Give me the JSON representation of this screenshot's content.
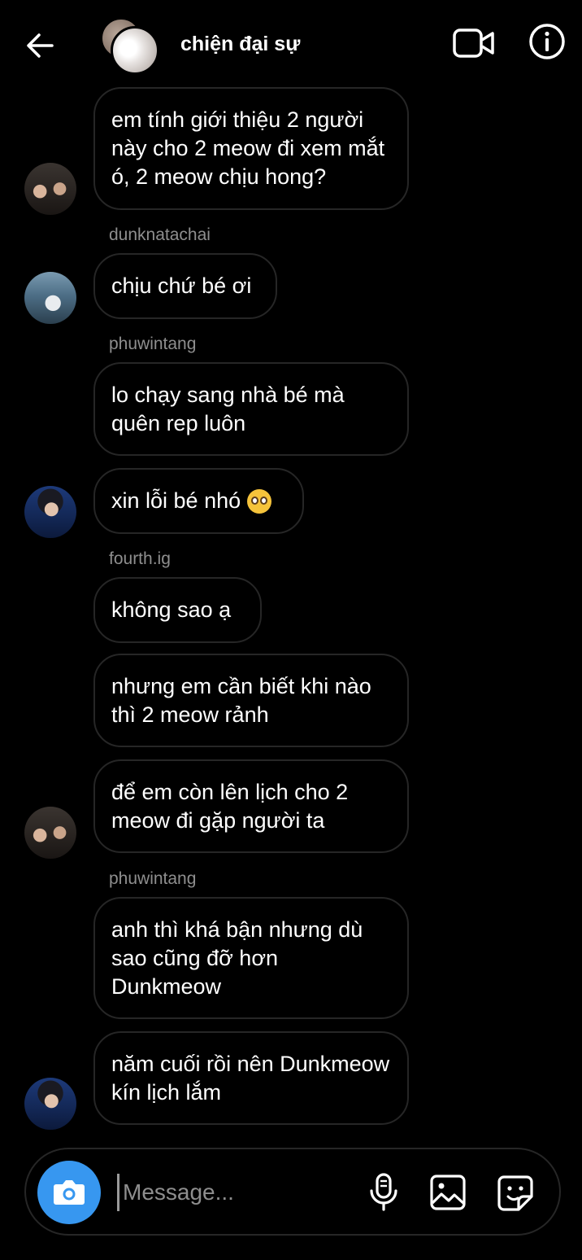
{
  "header": {
    "title": "chiện đại sự",
    "back_icon": "arrow-left-icon",
    "video_icon": "video-call-icon",
    "info_icon": "info-icon"
  },
  "messages": [
    {
      "text": "em tính giới thiệu 2 người này cho 2 meow đi xem mắt ó, 2 meow chịu hong?"
    },
    {
      "username": "dunknatachai",
      "text": "chịu chứ bé ơi"
    },
    {
      "username": "phuwintang",
      "text": "lo chạy sang nhà bé mà quên rep luôn"
    },
    {
      "text": "xin lỗi bé nhó"
    },
    {
      "username": "fourth.ig",
      "text": "không sao ạ"
    },
    {
      "text": "nhưng em cần biết khi nào thì 2 meow rảnh"
    },
    {
      "text": "để em còn lên lịch cho 2 meow đi gặp người ta"
    },
    {
      "username": "phuwintang",
      "text": "anh thì khá bận nhưng dù sao cũng đỡ hơn Dunkmeow"
    },
    {
      "text": "năm cuối rồi nên Dunkmeow kín lịch lắm"
    }
  ],
  "composer": {
    "placeholder": "Message...",
    "camera_icon": "camera-icon",
    "mic_icon": "microphone-icon",
    "gallery_icon": "gallery-icon",
    "sticker_icon": "sticker-icon"
  },
  "colors": {
    "background": "#000000",
    "bubble_border": "#262626",
    "username": "#8e8e8e",
    "camera_button": "#3797f0"
  }
}
